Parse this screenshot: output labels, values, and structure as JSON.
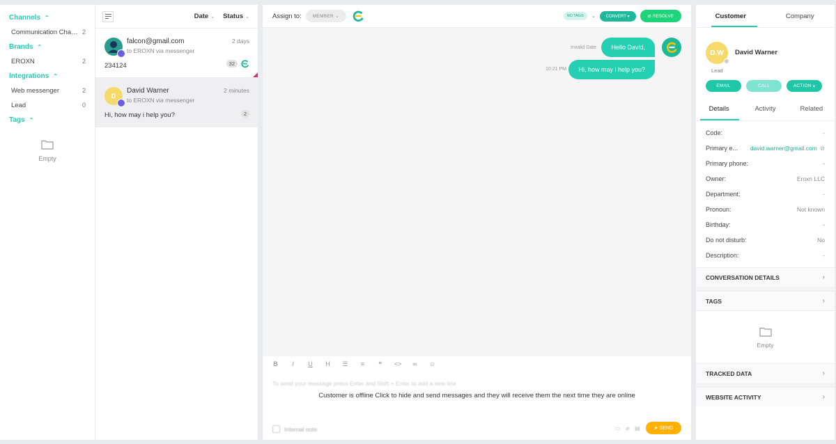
{
  "sidebar": {
    "channels_title": "Channels",
    "channels": [
      {
        "label": "Communication Chan...",
        "count": "2"
      }
    ],
    "brands_title": "Brands",
    "brands": [
      {
        "label": "EROXN",
        "count": "2"
      }
    ],
    "integrations_title": "Integrations",
    "integrations": [
      {
        "label": "Web messenger",
        "count": "2"
      },
      {
        "label": "Lead",
        "count": "0"
      }
    ],
    "tags_title": "Tags",
    "empty_label": "Empty"
  },
  "conv_list": {
    "filter_date": "Date",
    "filter_status": "Status",
    "items": [
      {
        "name": "falcon@gmail.com",
        "sub": "to EROXN via messenger",
        "time": "2 days",
        "preview": "234124",
        "count": "32"
      },
      {
        "initial": "D",
        "name": "David Warner",
        "sub": "to EROXN via messenger",
        "time": "2 minutes",
        "preview": "Hi, how may i help you?",
        "count": "2"
      }
    ]
  },
  "chat": {
    "assign_label": "Assign to:",
    "member_label": "MEMBER",
    "no_tags": "NO TAGS",
    "convert": "CONVERT",
    "resolve": "RESOLVE",
    "messages": [
      {
        "text": "Hello David,",
        "time": "Invalid Date"
      },
      {
        "text": "Hi, how may i help you?",
        "time": "10:21 PM"
      }
    ],
    "placeholder": "To send your message press Enter and Shift + Enter to add a new line",
    "offline_notice": "Customer is offline Click to hide and send messages and they will receive them the next time they are online",
    "internal_note": "Internal note",
    "send": "SEND"
  },
  "panel": {
    "tab_customer": "Customer",
    "tab_company": "Company",
    "initials": "D.W",
    "name": "David Warner",
    "state": "Lead",
    "btn_email": "EMAIL",
    "btn_call": "CALL",
    "btn_action": "ACTION",
    "subtab_details": "Details",
    "subtab_activity": "Activity",
    "subtab_related": "Related",
    "details": [
      {
        "key": "Code:",
        "value": "-"
      },
      {
        "key": "Primary e...",
        "value": "david.warner@gmail.com"
      },
      {
        "key": "Primary phone:",
        "value": "-"
      },
      {
        "key": "Owner:",
        "value": "Eroxn LLC"
      },
      {
        "key": "Department:",
        "value": "-"
      },
      {
        "key": "Pronoun:",
        "value": "Not known"
      },
      {
        "key": "Birthday:",
        "value": "-"
      },
      {
        "key": "Do not disturb:",
        "value": "No"
      },
      {
        "key": "Description:",
        "value": "-"
      }
    ],
    "section_conversation": "CONVERSATION DETAILS",
    "section_tags": "TAGS",
    "tags_empty": "Empty",
    "section_tracked": "TRACKED DATA",
    "section_website": "WEBSITE ACTIVITY"
  },
  "colors": {
    "accent": "#25cbb1",
    "resolve": "#1ed47a",
    "send": "#ffb000",
    "messenger": "#6a5fe0"
  }
}
